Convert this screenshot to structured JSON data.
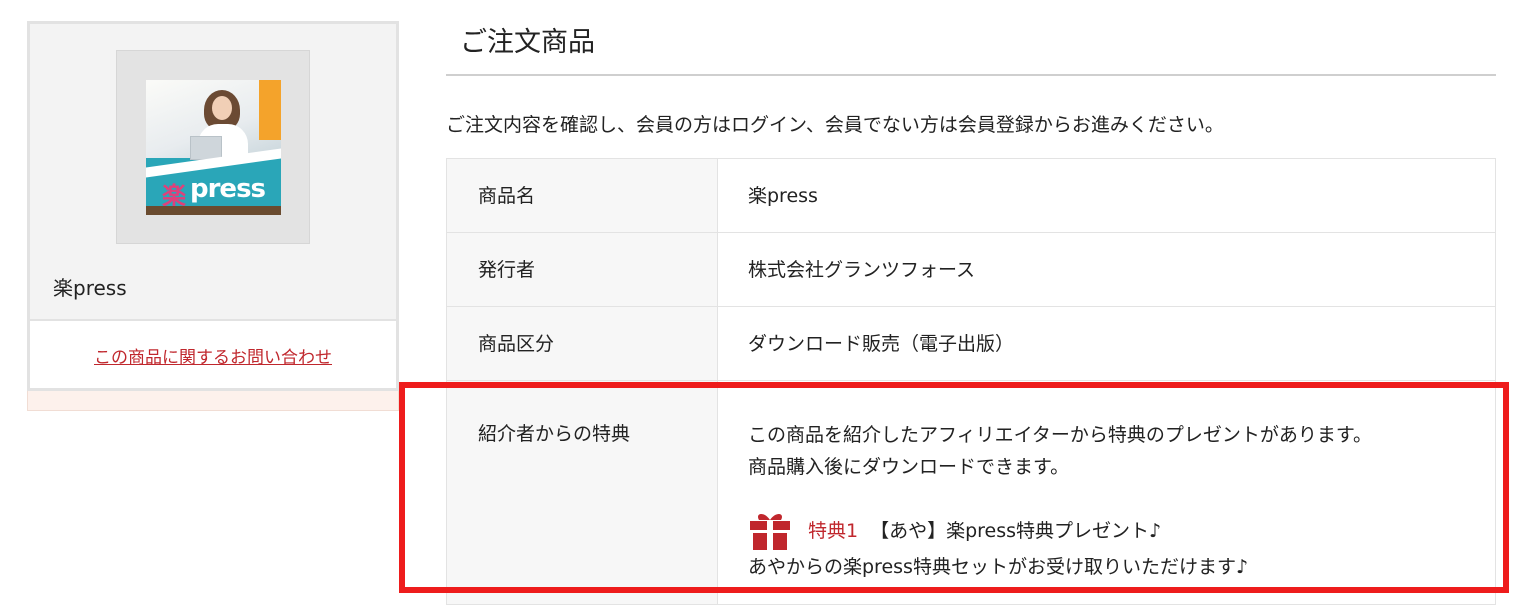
{
  "sidebar": {
    "product_name": "楽press",
    "inquiry_link": "この商品に関するお問い合わせ",
    "thumbnail": {
      "logo_kanji": "楽",
      "logo_text": "press"
    }
  },
  "main": {
    "heading": "ご注文商品",
    "intro": "ご注文内容を確認し、会員の方はログイン、会員でない方は会員登録からお進みください。",
    "rows": [
      {
        "label": "商品名",
        "value": "楽press"
      },
      {
        "label": "発行者",
        "value": "株式会社グランツフォース"
      },
      {
        "label": "商品区分",
        "value": "ダウンロード販売（電子出版）"
      }
    ],
    "benefit": {
      "label": "紹介者からの特典",
      "line1": "この商品を紹介したアフィリエイターから特典のプレゼントがあります。",
      "line2": "商品購入後にダウンロードできます。",
      "gift_tag": "特典1",
      "gift_title": "【あや】楽press特典プレゼント♪",
      "gift_desc": "あやからの楽press特典セットがお受け取りいただけます♪"
    }
  },
  "colors": {
    "accent_red": "#c0272d",
    "highlight_red": "#ee1c1c"
  },
  "icons": {
    "gift": "gift-icon"
  }
}
